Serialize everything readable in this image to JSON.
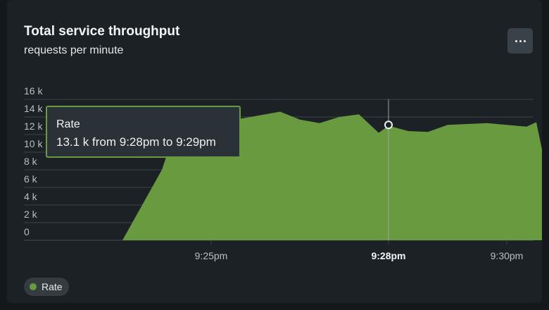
{
  "header": {
    "title": "Total service throughput",
    "subtitle": "requests per minute",
    "menu_icon": "more-horizontal-icon"
  },
  "tooltip": {
    "title": "Rate",
    "text": "13.1 k from 9:28pm to 9:29pm"
  },
  "legend": {
    "label": "Rate",
    "color": "#6a9a3f"
  },
  "colors": {
    "area": "#6a9a3f",
    "background": "#1c2126",
    "grid": "#3c444a"
  },
  "chart_data": {
    "type": "area",
    "title": "Total service throughput",
    "subtitle": "requests per minute",
    "xlabel": "",
    "ylabel": "",
    "x_ticks": [
      "9:25pm",
      "9:28pm",
      "9:30pm"
    ],
    "x_active_tick": "9:28pm",
    "y_ticks": [
      "0",
      "2 k",
      "4 k",
      "6 k",
      "8 k",
      "10 k",
      "12 k",
      "14 k",
      "16 k"
    ],
    "ylim": [
      0,
      16000
    ],
    "grid": true,
    "legend": "bottom-left",
    "series": [
      {
        "name": "Rate",
        "x": [
          "9:22:50",
          "9:23:30",
          "9:24:10",
          "9:24:30",
          "9:24:50",
          "9:25:10",
          "9:25:30",
          "9:25:50",
          "9:26:10",
          "9:26:30",
          "9:26:50",
          "9:27:10",
          "9:27:30",
          "9:27:50",
          "9:28:00",
          "9:28:20",
          "9:28:40",
          "9:29:00",
          "9:29:20",
          "9:29:40",
          "9:30:20",
          "9:30:30"
        ],
        "values": [
          0,
          0,
          8000,
          14700,
          14200,
          14400,
          13800,
          14200,
          14600,
          13700,
          13300,
          14000,
          14300,
          12200,
          13000,
          12400,
          12300,
          13100,
          13200,
          13300,
          12900,
          13400
        ]
      }
    ],
    "series_tail": [
      {
        "x": "9:30:40",
        "value": 8000
      },
      {
        "x": "9:31:00",
        "value": 0
      }
    ],
    "hover": {
      "x": "9:28:00",
      "value": 13100
    }
  }
}
